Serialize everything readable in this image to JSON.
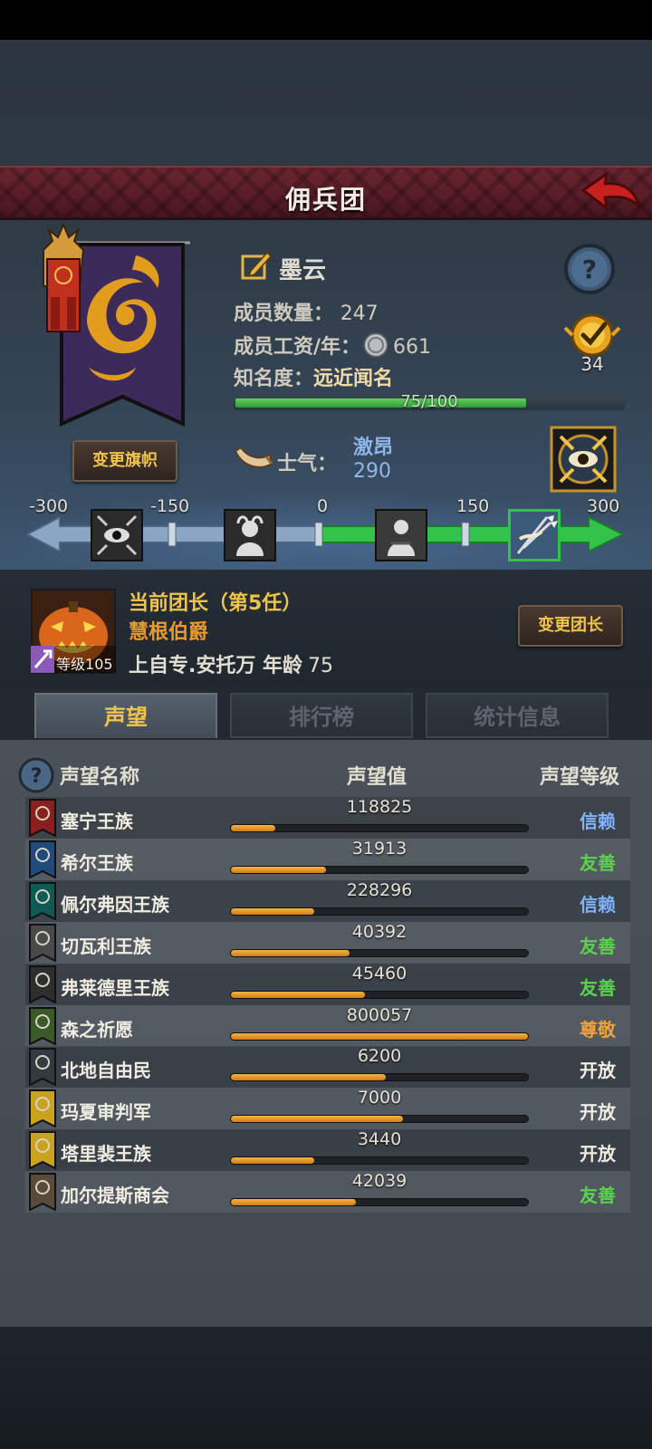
{
  "header": {
    "title": "佣兵团"
  },
  "banner": {
    "change_label": "变更旗帜"
  },
  "company": {
    "name": "墨云",
    "members_label": "成员数量：",
    "members": "247",
    "wage_label": "成员工资/年：",
    "wage": "661",
    "fame_label": "知名度：",
    "fame_value": "远近闻名",
    "fame_progress": "75/100",
    "fame_fraction": 0.75,
    "medal_count": "34"
  },
  "morale": {
    "label": "士气：",
    "state": "激昂",
    "value": "290",
    "ticks": [
      "-300",
      "-150",
      "0",
      "150",
      "300"
    ],
    "fraction": 0.983,
    "colors": {
      "positive": "#33c24a",
      "negative": "#6d8aa8"
    }
  },
  "leader": {
    "title": "当前团长（第5任）",
    "name": "慧根伯爵",
    "level_label": "等级",
    "level": "105",
    "origin": "上自专.安托万",
    "age_label": "年龄",
    "age": "75",
    "change_label": "变更团长"
  },
  "tabs": [
    {
      "label": "声望"
    },
    {
      "label": "排行榜"
    },
    {
      "label": "统计信息"
    }
  ],
  "reputation": {
    "headers": {
      "name": "声望名称",
      "value": "声望值",
      "level": "声望等级"
    },
    "level_colors": {
      "信赖": "#7fb2ff",
      "友善": "#5bd24d",
      "尊敬": "#f0a23a",
      "开放": "#f0ece2"
    },
    "rows": [
      {
        "name": "塞宁王族",
        "value": "118825",
        "fill": 0.15,
        "level": "信赖",
        "icon": "crown-banner-icon",
        "icon_color": "#8a1f1f"
      },
      {
        "name": "希尔王族",
        "value": "31913",
        "fill": 0.32,
        "level": "友善",
        "icon": "skull-banner-icon",
        "icon_color": "#1f4a7a"
      },
      {
        "name": "佩尔弗因王族",
        "value": "228296",
        "fill": 0.28,
        "level": "信赖",
        "icon": "moon-banner-icon",
        "icon_color": "#0f5a55"
      },
      {
        "name": "切瓦利王族",
        "value": "40392",
        "fill": 0.4,
        "level": "友善",
        "icon": "scales-banner-icon",
        "icon_color": "#4a4a4a"
      },
      {
        "name": "弗莱德里王族",
        "value": "45460",
        "fill": 0.45,
        "level": "友善",
        "icon": "ram-banner-icon",
        "icon_color": "#2e2e2e"
      },
      {
        "name": "森之祈愿",
        "value": "800057",
        "fill": 1.0,
        "level": "尊敬",
        "icon": "tree-banner-icon",
        "icon_color": "#3a5a2a"
      },
      {
        "name": "北地自由民",
        "value": "6200",
        "fill": 0.52,
        "level": "开放",
        "icon": "axe-banner-icon",
        "icon_color": "#333a40"
      },
      {
        "name": "玛夏审判军",
        "value": "7000",
        "fill": 0.58,
        "level": "开放",
        "icon": "sun-banner-icon",
        "icon_color": "#c9a21f"
      },
      {
        "name": "塔里裴王族",
        "value": "3440",
        "fill": 0.28,
        "level": "开放",
        "icon": "castle-banner-icon",
        "icon_color": "#c9a21f"
      },
      {
        "name": "加尔提斯商会",
        "value": "42039",
        "fill": 0.42,
        "level": "友善",
        "icon": "chest-banner-icon",
        "icon_color": "#5a4a3a"
      }
    ]
  }
}
